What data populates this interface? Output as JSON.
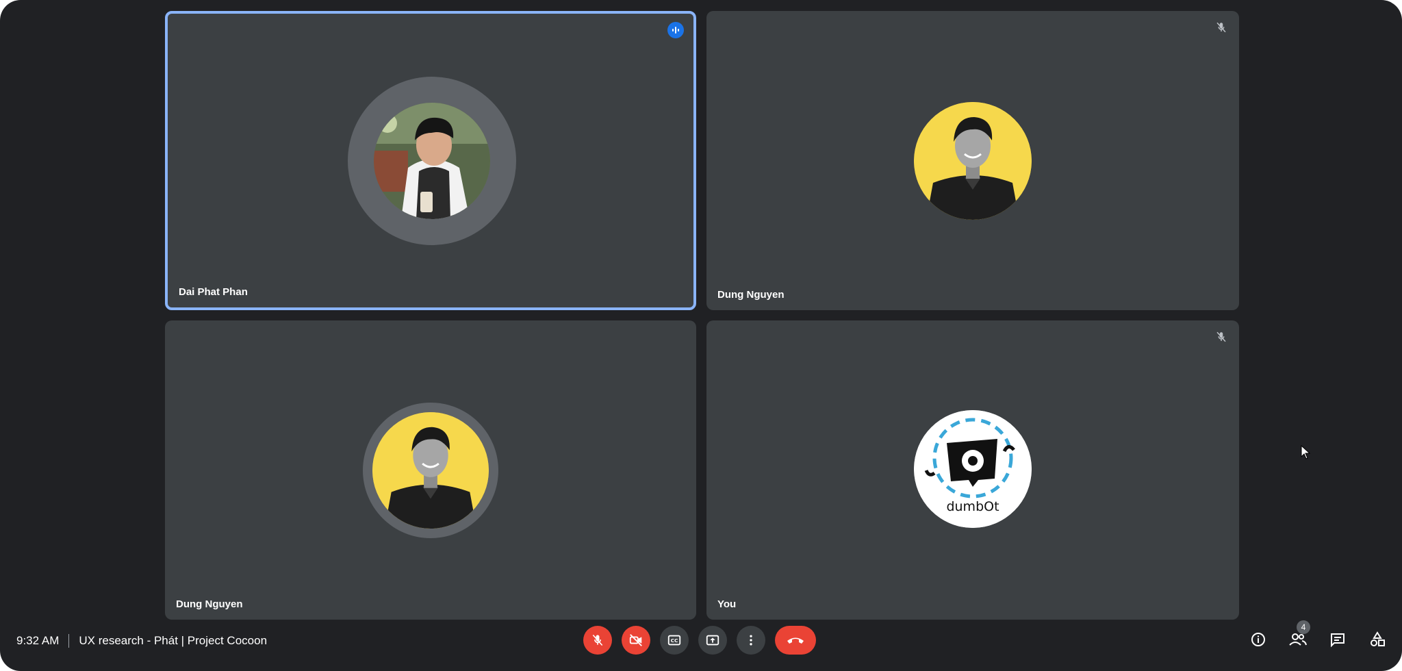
{
  "tiles": [
    {
      "name": "Dai Phat Phan",
      "speaking": true,
      "top_icon": "speaking-indicator-icon"
    },
    {
      "name": "Dung Nguyen",
      "speaking": false,
      "top_icon": "mic-off-icon"
    },
    {
      "name": "Dung Nguyen",
      "speaking": false,
      "top_icon": null
    },
    {
      "name": "You",
      "speaking": false,
      "top_icon": "mic-off-icon",
      "avatar_logo_text": "dumbOt"
    }
  ],
  "bottombar": {
    "time": "9:32 AM",
    "meeting_title": "UX research - Phát | Project Cocoon",
    "participant_count": "4"
  },
  "controls": [
    {
      "name": "mic-off-button",
      "icon": "mic-off-icon"
    },
    {
      "name": "camera-off-button",
      "icon": "videocam-off-icon"
    },
    {
      "name": "captions-button",
      "icon": "closed-caption-icon"
    },
    {
      "name": "present-button",
      "icon": "present-screen-icon"
    },
    {
      "name": "more-options-button",
      "icon": "more-vert-icon"
    },
    {
      "name": "leave-call-button",
      "icon": "call-end-icon"
    }
  ],
  "right_icons": [
    {
      "name": "meeting-details-button",
      "icon": "info-icon"
    },
    {
      "name": "people-button",
      "icon": "people-icon"
    },
    {
      "name": "chat-button",
      "icon": "chat-icon"
    },
    {
      "name": "activities-button",
      "icon": "activities-icon"
    }
  ],
  "colors": {
    "background": "#202124",
    "tile": "#3c4043",
    "speaking_border": "#8ab4f8",
    "danger": "#ea4335",
    "avatar_yellow": "#f6d84c",
    "logo_blue": "#3aa7d8"
  }
}
